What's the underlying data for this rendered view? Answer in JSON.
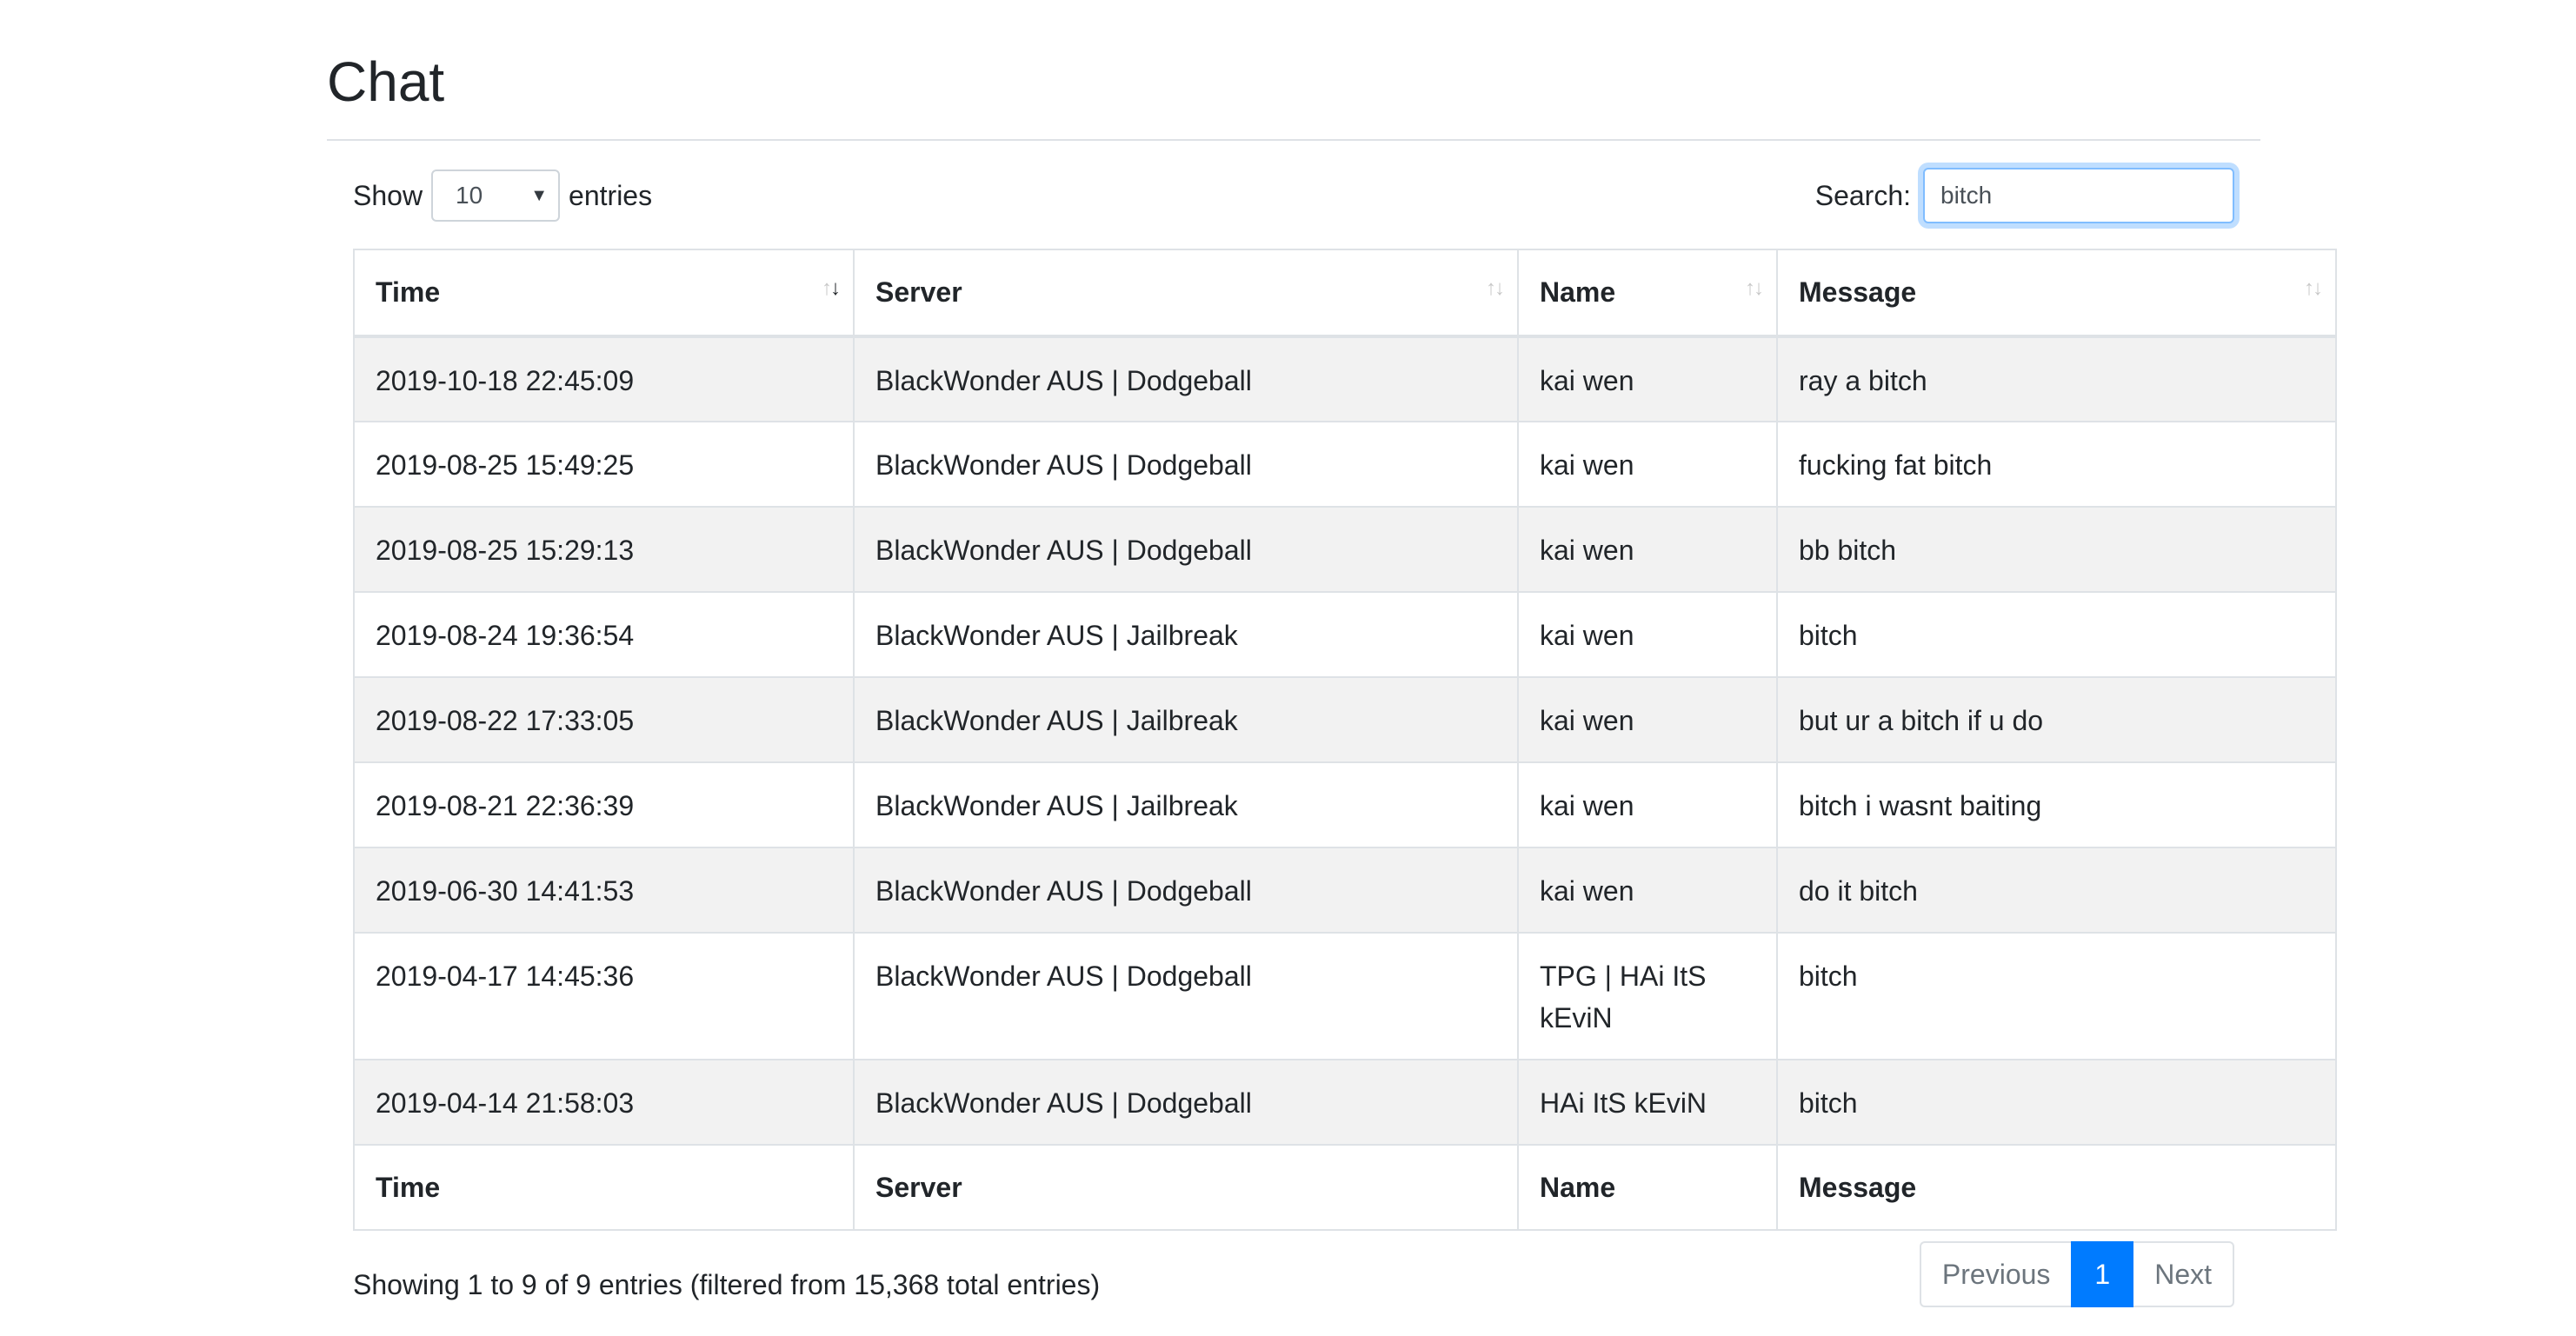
{
  "page": {
    "title": "Chat"
  },
  "controls": {
    "show_label": "Show",
    "entries_label": "entries",
    "length_value": "10",
    "search_label": "Search:",
    "search_value": "bitch"
  },
  "table": {
    "columns": [
      "Time",
      "Server",
      "Name",
      "Message"
    ],
    "rows": [
      {
        "time": "2019-10-18 22:45:09",
        "server": "BlackWonder AUS | Dodgeball",
        "name": "kai wen",
        "message": "ray a bitch"
      },
      {
        "time": "2019-08-25 15:49:25",
        "server": "BlackWonder AUS | Dodgeball",
        "name": "kai wen",
        "message": "fucking fat bitch"
      },
      {
        "time": "2019-08-25 15:29:13",
        "server": "BlackWonder AUS | Dodgeball",
        "name": "kai wen",
        "message": "bb bitch"
      },
      {
        "time": "2019-08-24 19:36:54",
        "server": "BlackWonder AUS | Jailbreak",
        "name": "kai wen",
        "message": "bitch"
      },
      {
        "time": "2019-08-22 17:33:05",
        "server": "BlackWonder AUS | Jailbreak",
        "name": "kai wen",
        "message": "but ur a bitch if u do"
      },
      {
        "time": "2019-08-21 22:36:39",
        "server": "BlackWonder AUS | Jailbreak",
        "name": "kai wen",
        "message": "bitch i wasnt baiting"
      },
      {
        "time": "2019-06-30 14:41:53",
        "server": "BlackWonder AUS | Dodgeball",
        "name": "kai wen",
        "message": "do it bitch"
      },
      {
        "time": "2019-04-17 14:45:36",
        "server": "BlackWonder AUS | Dodgeball",
        "name": "TPG | HAi ItS kEviN",
        "message": "bitch"
      },
      {
        "time": "2019-04-14 21:58:03",
        "server": "BlackWonder AUS | Dodgeball",
        "name": "HAi ItS kEviN",
        "message": "bitch"
      }
    ],
    "sort_icon": "sort-arrows-icon"
  },
  "footer": {
    "info": "Showing 1 to 9 of 9 entries (filtered from 15,368 total entries)",
    "previous_label": "Previous",
    "current_page": "1",
    "next_label": "Next"
  },
  "colors": {
    "accent": "#007bff",
    "stripe": "#f2f2f2",
    "border": "#dee2e6"
  }
}
